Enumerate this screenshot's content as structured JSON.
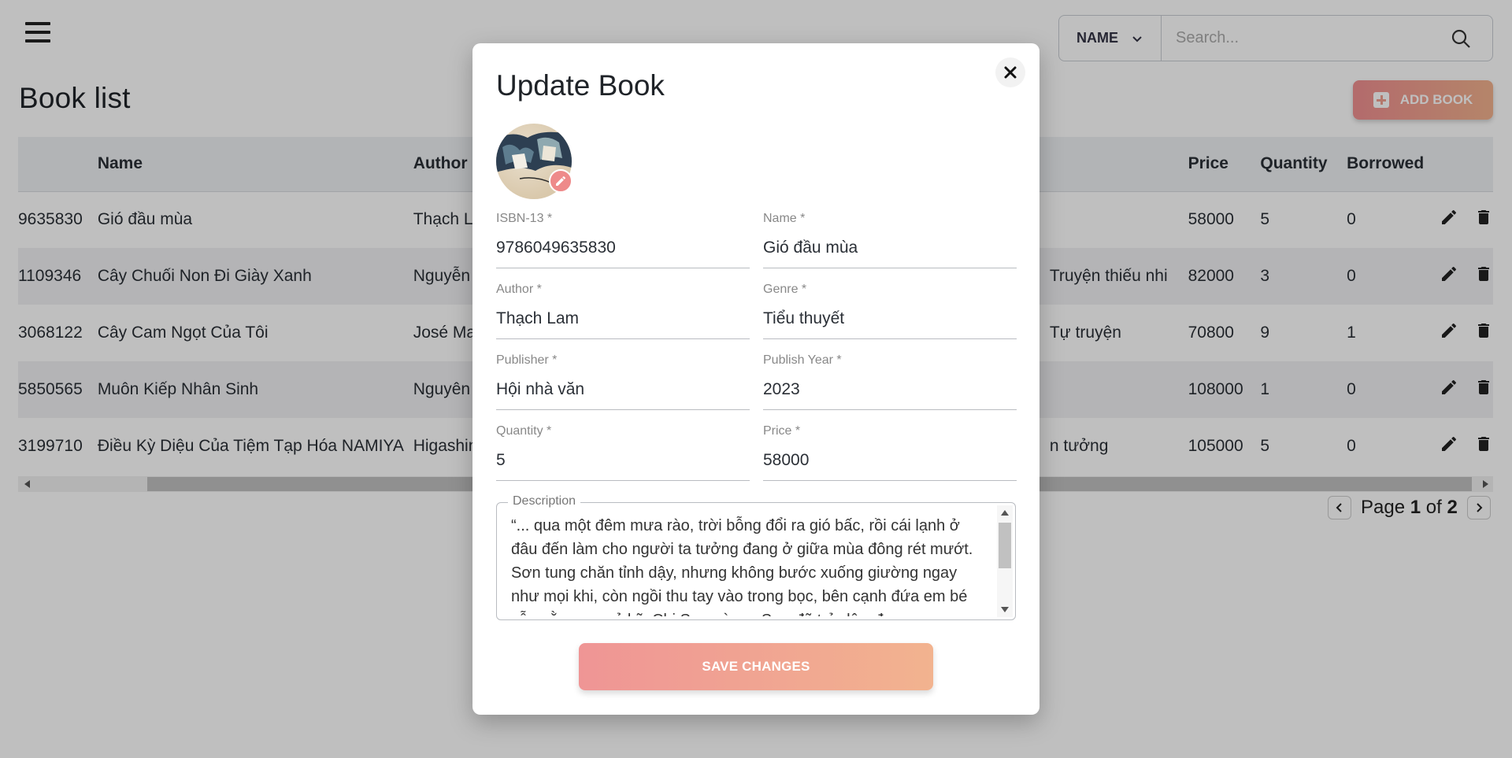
{
  "header": {
    "search_filter": "NAME",
    "search_placeholder": "Search..."
  },
  "page": {
    "title": "Book list",
    "add_button": "ADD BOOK"
  },
  "table": {
    "columns": [
      "Name",
      "Author",
      "Price",
      "Quantity",
      "Borrowed"
    ],
    "rows": [
      {
        "isbn": "9635830",
        "name": "Gió đầu mùa",
        "author": "Thạch La",
        "genre": "",
        "price": "58000",
        "quantity": "5",
        "borrowed": "0"
      },
      {
        "isbn": "1109346",
        "name": "Cây Chuối Non Đi Giày Xanh",
        "author": "Nguyễn",
        "genre": "Truyện thiếu nhi",
        "price": "82000",
        "quantity": "3",
        "borrowed": "0"
      },
      {
        "isbn": "3068122",
        "name": "Cây Cam Ngọt Của Tôi",
        "author": "José Ma",
        "genre": "Tự truyện",
        "price": "70800",
        "quantity": "9",
        "borrowed": "1"
      },
      {
        "isbn": "5850565",
        "name": "Muôn Kiếp Nhân Sinh",
        "author": "Nguyên",
        "genre": "",
        "price": "108000",
        "quantity": "1",
        "borrowed": "0"
      },
      {
        "isbn": "3199710",
        "name": "Điều Kỳ Diệu Của Tiệm Tạp Hóa NAMIYA",
        "author": "Higashin",
        "genre": "n tưởng",
        "price": "105000",
        "quantity": "5",
        "borrowed": "0"
      }
    ]
  },
  "pagination": {
    "label": "Page",
    "current": "1",
    "of": "of",
    "total": "2"
  },
  "modal": {
    "title": "Update Book",
    "cover_text": "Gió đầu mùa",
    "fields": {
      "isbn": {
        "label": "ISBN-13 *",
        "value": "9786049635830"
      },
      "name": {
        "label": "Name *",
        "value": "Gió đầu mùa"
      },
      "author": {
        "label": "Author *",
        "value": "Thạch Lam"
      },
      "genre": {
        "label": "Genre *",
        "value": "Tiểu thuyết"
      },
      "publisher": {
        "label": "Publisher *",
        "value": "Hội nhà văn"
      },
      "publish_year": {
        "label": "Publish Year *",
        "value": "2023"
      },
      "quantity": {
        "label": "Quantity *",
        "value": "5"
      },
      "price": {
        "label": "Price *",
        "value": "58000"
      }
    },
    "description": {
      "label": "Description",
      "value": "“... qua một đêm mưa rào, trời bỗng đổi ra gió bấc, rồi cái lạnh ở đâu đến làm cho người ta tưởng đang ở giữa mùa  đông rét mướt. Sơn tung chăn tỉnh dậy, nhưng không bước xuống giường ngay như mọi khi, còn ngồi thu tay vào  trong bọc, bên cạnh đứa em bé vẫn nằm co ngủ kỹ. Chị Sơn và mẹ Sơn đã trở dậy, đang"
    },
    "save_button": "SAVE CHANGES"
  },
  "colors": {
    "accent_start": "#ef9595",
    "accent_end": "#f2b38f"
  }
}
